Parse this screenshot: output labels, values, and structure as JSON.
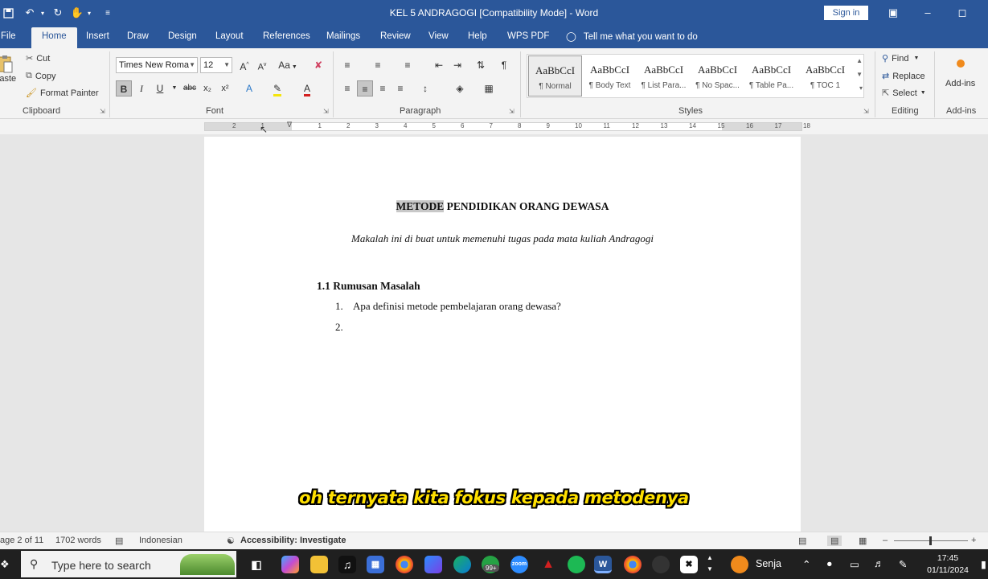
{
  "window": {
    "title": "KEL 5 ANDRAGOGI [Compatibility Mode]  -  Word",
    "signin_label": "Sign in"
  },
  "tabs": [
    "File",
    "Home",
    "Insert",
    "Draw",
    "Design",
    "Layout",
    "References",
    "Mailings",
    "Review",
    "View",
    "Help",
    "WPS PDF"
  ],
  "active_tab": "Home",
  "tell_me": "Tell me what you want to do",
  "clipboard": {
    "paste_label": "Paste",
    "cut_label": "Cut",
    "copy_label": "Copy",
    "format_painter_label": "Format Painter",
    "group_label": "Clipboard"
  },
  "font": {
    "family": "Times New Roma",
    "size": "12",
    "case_label": "Aa",
    "bold_label": "B",
    "italic_label": "I",
    "underline_label": "U",
    "strike_label": "abc",
    "sub_label": "x₂",
    "sup_label": "x²",
    "group_label": "Font"
  },
  "paragraph": {
    "group_label": "Paragraph"
  },
  "styles": {
    "items": [
      {
        "preview": "AaBbCcI",
        "name": "¶ Normal"
      },
      {
        "preview": "AaBbCcI",
        "name": "¶ Body Text"
      },
      {
        "preview": "AaBbCcI",
        "name": "¶ List Para..."
      },
      {
        "preview": "AaBbCcI",
        "name": "¶ No Spac..."
      },
      {
        "preview": "AaBbCcI",
        "name": "¶ Table Pa..."
      },
      {
        "preview": "AaBbCcI",
        "name": "¶ TOC 1"
      }
    ],
    "group_label": "Styles"
  },
  "editing": {
    "find_label": "Find",
    "replace_label": "Replace",
    "select_label": "Select",
    "group_label": "Editing"
  },
  "addins": {
    "button_label": "Add-ins",
    "group_label": "Add-ins"
  },
  "ruler_numbers": [
    "2",
    "1",
    "1",
    "2",
    "3",
    "4",
    "5",
    "6",
    "7",
    "8",
    "9",
    "10",
    "11",
    "12",
    "13",
    "14",
    "15",
    "16",
    "17",
    "18"
  ],
  "document": {
    "title_highlight": "METODE",
    "title_rest": " PENDIDIKAN ORANG DEWASA",
    "subtitle": "Makalah ini di buat untuk memenuhi tugas pada mata kuliah Andragogi",
    "heading": "1.1 Rumusan Masalah",
    "list": [
      {
        "num": "1.",
        "text": "Apa definisi metode pembelajaran orang dewasa?"
      },
      {
        "num": "2.",
        "text": ""
      }
    ]
  },
  "caption": "oh ternyata kita fokus kepada metodenya",
  "statusbar": {
    "page": "age 2 of 11",
    "words": "1702 words",
    "language": "Indonesian",
    "accessibility": "Accessibility: Investigate"
  },
  "taskbar": {
    "search_placeholder": "Type here to search",
    "badge": "99+",
    "weather": "Senja",
    "time": "17:45",
    "date": "01/11/2024"
  },
  "colors": {
    "word_blue": "#2b579a",
    "taskbar": "#202020",
    "caption_yellow": "#ffe000"
  }
}
